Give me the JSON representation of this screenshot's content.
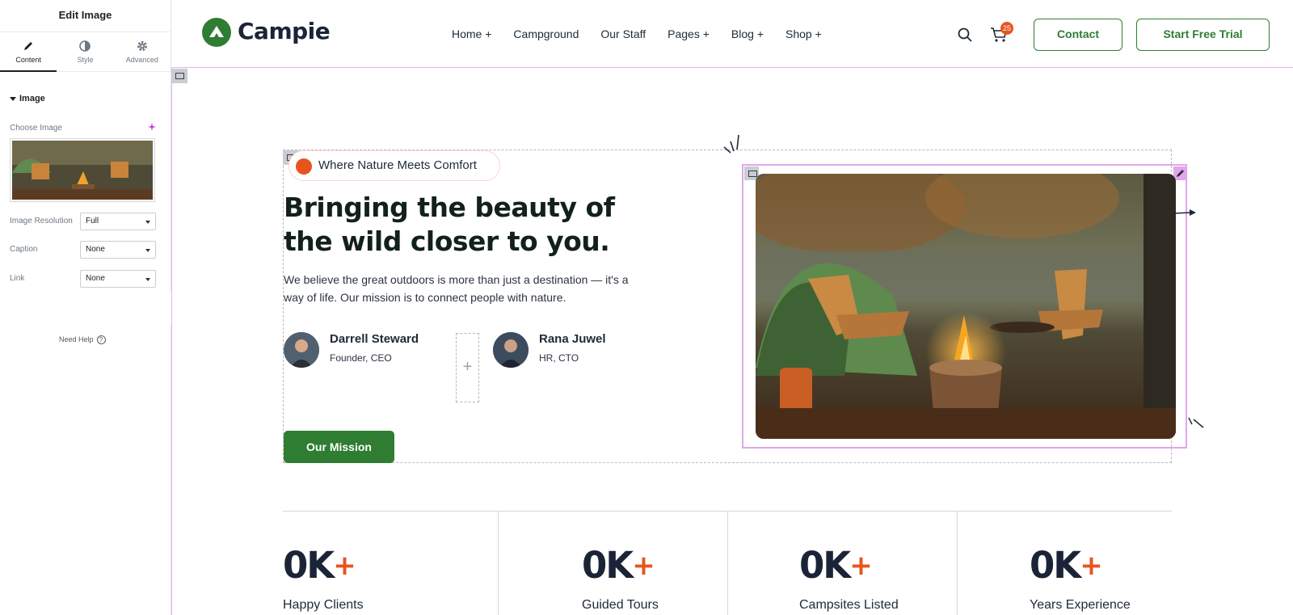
{
  "panel": {
    "title": "Edit Image",
    "tabs": [
      {
        "label": "Content",
        "icon": "pencil-icon",
        "active": true
      },
      {
        "label": "Style",
        "icon": "half-circle-icon",
        "active": false
      },
      {
        "label": "Advanced",
        "icon": "gear-icon",
        "active": false
      }
    ],
    "section": "Image",
    "choose_image_label": "Choose Image",
    "fields": [
      {
        "label": "Image Resolution",
        "value": "Full"
      },
      {
        "label": "Caption",
        "value": "None"
      },
      {
        "label": "Link",
        "value": "None"
      }
    ],
    "need_help": "Need Help",
    "help_glyph": "?",
    "collapse_glyph": "‹"
  },
  "header": {
    "logo_text": "Campie",
    "nav": [
      "Home +",
      "Campground",
      "Our Staff",
      "Pages +",
      "Blog +",
      "Shop +"
    ],
    "cart_count": "25",
    "contact_label": "Contact",
    "trial_label": "Start Free Trial",
    "brand_color": "#2e7d32",
    "accent_color": "#e8541f"
  },
  "hero": {
    "tagline": "Where Nature Meets Comfort",
    "title": "Bringing the beauty of the wild closer to you.",
    "description": "We believe the great outdoors is more than just a destination — it's a way of life. Our mission is to connect people with nature.",
    "people": [
      {
        "name": "Darrell Steward",
        "role": "Founder, CEO"
      },
      {
        "name": "Rana Juwel",
        "role": "HR, CTO"
      }
    ],
    "add_glyph": "+",
    "mission_button": "Our Mission"
  },
  "stats": [
    {
      "value": "0K",
      "suffix": "+",
      "label": "Happy Clients"
    },
    {
      "value": "0K",
      "suffix": "+",
      "label": "Guided Tours"
    },
    {
      "value": "0K",
      "suffix": "+",
      "label": "Campsites Listed"
    },
    {
      "value": "0K",
      "suffix": "+",
      "label": "Years Experience"
    }
  ]
}
